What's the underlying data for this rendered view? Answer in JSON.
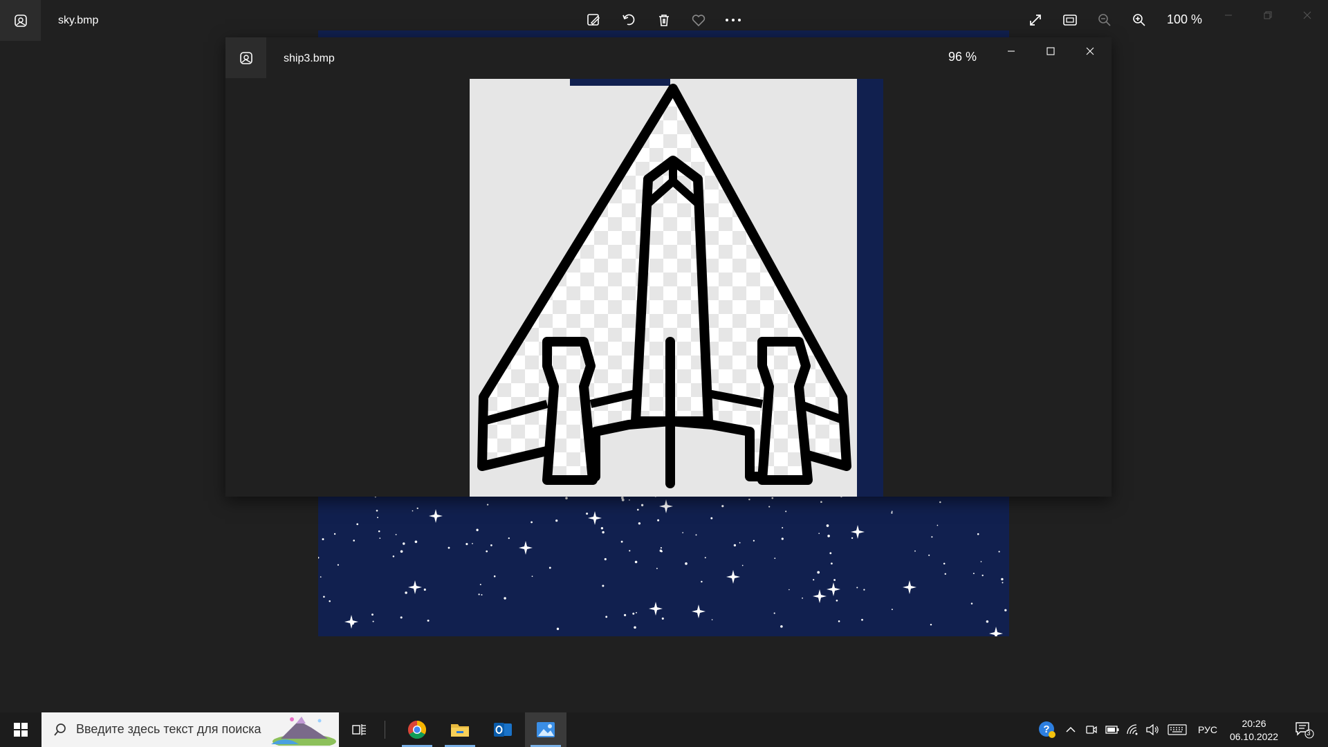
{
  "back_window": {
    "title": "sky.bmp",
    "zoom": "100 %",
    "icons": [
      "photos-app-icon",
      "edit-image-icon",
      "rotate-icon",
      "delete-icon",
      "favorite-icon",
      "more-icon",
      "fullscreen-icon",
      "fit-window-icon",
      "zoom-out-icon",
      "zoom-in-icon"
    ]
  },
  "front_window": {
    "title": "ship3.bmp",
    "zoom": "96 %",
    "icons": [
      "photos-app-icon",
      "minimize-icon",
      "maximize-icon",
      "close-icon"
    ]
  },
  "taskbar": {
    "search_placeholder": "Введите здесь текст для поиска",
    "apps": [
      "task-view",
      "chrome",
      "file-explorer",
      "outlook",
      "photos"
    ],
    "language": "РУС",
    "time": "20:26",
    "date": "06.10.2022",
    "notification_count": "3"
  },
  "colors": {
    "window_bg": "#202020",
    "sky_bg": "#11204f",
    "taskbar_bg": "#1c1c1c",
    "accent_underline": "#7ab0e6"
  }
}
